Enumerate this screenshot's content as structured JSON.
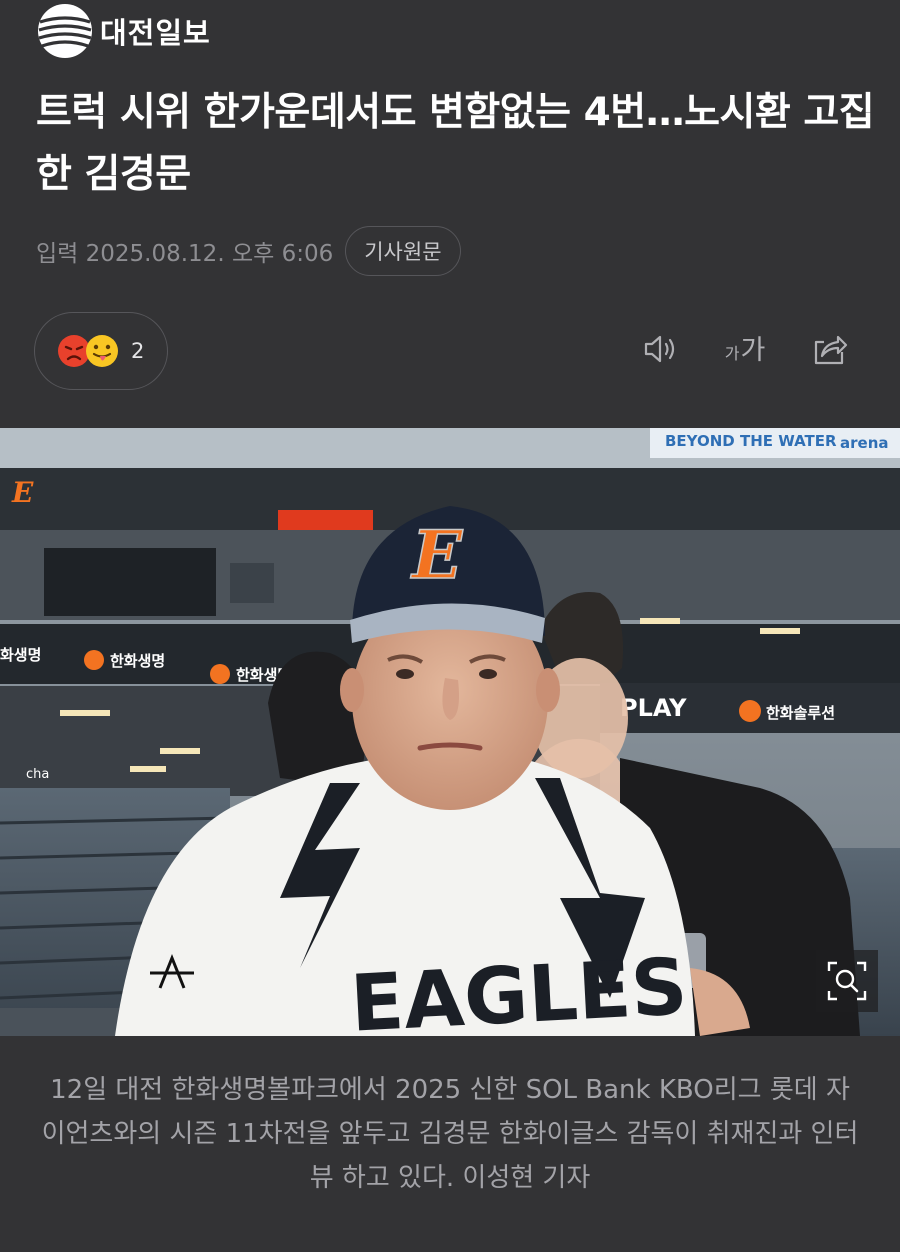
{
  "publisher": {
    "name": "대전일보",
    "logo_icon": "globe-stripes-logo"
  },
  "article": {
    "headline": "트럭 시위 한가운데서도 변함없는 4번…노시환 고집한 김경문",
    "dateline": "입력 2025.08.12. 오후 6:06",
    "source_button": "기사원문"
  },
  "reactions": {
    "icons": [
      "angry-face-icon",
      "tongue-out-face-icon"
    ],
    "count": "2"
  },
  "toolbar": {
    "font_size_small": "가",
    "font_size_large": "가",
    "icons": [
      "speaker-icon",
      "font-size-icon",
      "share-icon"
    ]
  },
  "photo": {
    "cap_letter": "E",
    "jersey_text": "EAGLES",
    "stadium_signs": [
      "BEYOND THE WATER",
      "arena",
      "한화생명",
      "한화생명",
      "PLAY",
      "한화솔루션",
      "cha"
    ],
    "zoom_icon": "zoom-icon"
  },
  "caption": "12일 대전 한화생명볼파크에서 2025 신한 SOL Bank KBO리그 롯데 자이언츠와의 시즌 11차전을 앞두고 김경문 한화이글스 감독이 취재진과 인터뷰 하고 있다. 이성현 기자",
  "colors": {
    "background": "#333335",
    "muted_text": "#8e8e92",
    "eagles_orange": "#f37321",
    "navy": "#1b2436"
  }
}
